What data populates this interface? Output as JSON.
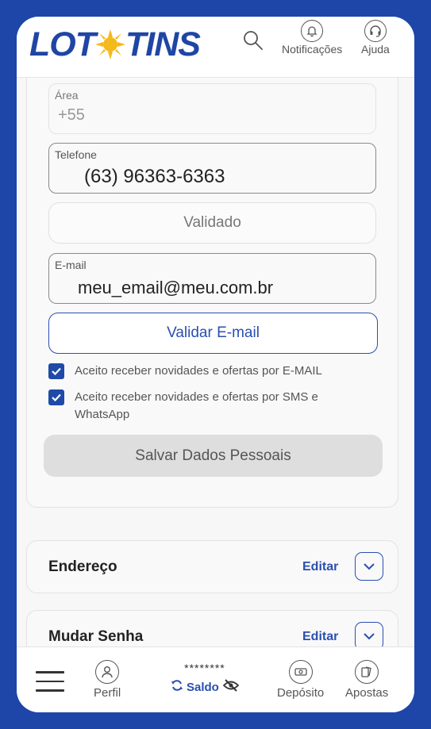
{
  "brand": {
    "logo_left": "LOT",
    "logo_right": "TINS",
    "primary": "#1f45a5",
    "sun": "#f4b91a"
  },
  "header": {
    "notifications_label": "Notificações",
    "help_label": "Ajuda"
  },
  "form": {
    "area_label": "Área",
    "area_value": "+55",
    "phone_label": "Telefone",
    "phone_value": "(63) 96363-6363",
    "validated_label": "Validado",
    "email_label": "E-mail",
    "email_value": "meu_email@meu.com.br",
    "validate_email_label": "Validar E-mail",
    "optin_email": "Aceito receber novidades e ofertas por E-MAIL",
    "optin_sms": "Aceito receber novidades e ofertas por SMS e WhatsApp",
    "save_label": "Salvar Dados Pessoais"
  },
  "sections": [
    {
      "title": "Endereço",
      "edit_label": "Editar"
    },
    {
      "title": "Mudar Senha",
      "edit_label": "Editar"
    }
  ],
  "nav": {
    "profile_label": "Perfil",
    "balance_masked": "********",
    "balance_label": "Saldo",
    "deposit_label": "Depósito",
    "bets_label": "Apostas"
  }
}
